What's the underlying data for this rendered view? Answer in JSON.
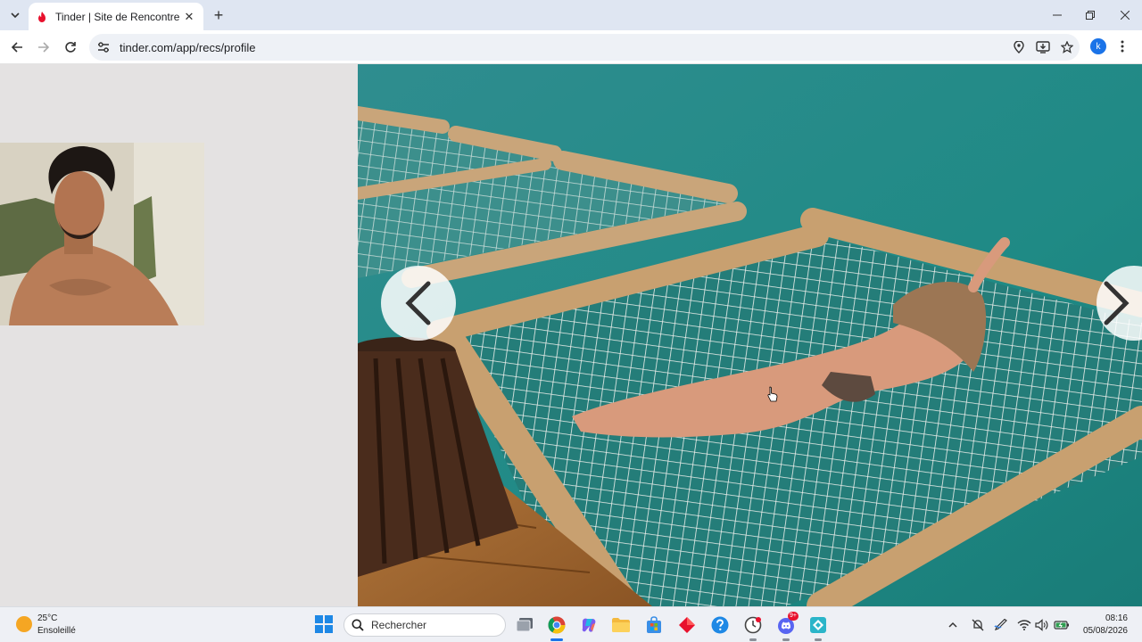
{
  "browser": {
    "tab_title": "Tinder | Site de Rencontre",
    "url": "tinder.com/app/recs/profile",
    "profile_initial": "k",
    "tab_icon": "tinder-flame-icon"
  },
  "page": {
    "profile_photo_alt": "photo-gallery",
    "icons": {
      "prev": "chevron-left-icon",
      "next": "chevron-right-icon"
    }
  },
  "taskbar": {
    "weather_temp": "25°C",
    "weather_desc": "Ensoleillé",
    "search_placeholder": "Rechercher",
    "time": "08:16",
    "date": "05/08/2026",
    "discord_badge": "9+"
  },
  "colors": {
    "accent": "#1a73e8",
    "tinder": "#e8112d",
    "taskbar_bg": "#eef0f5"
  }
}
